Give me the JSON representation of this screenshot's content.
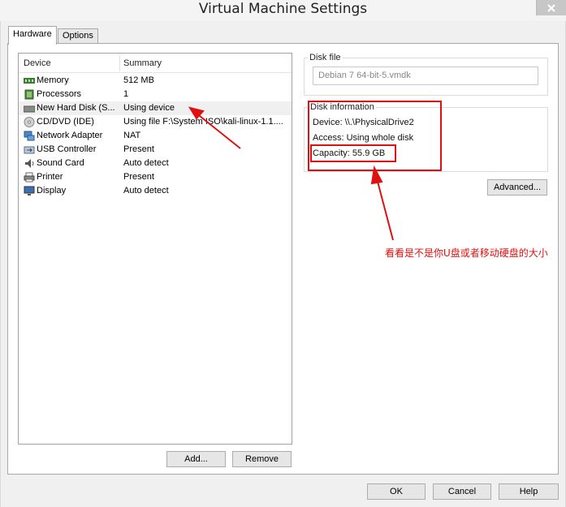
{
  "window": {
    "title": "Virtual Machine Settings"
  },
  "tabs": [
    {
      "label": "Hardware"
    },
    {
      "label": "Options"
    }
  ],
  "devices": {
    "header": {
      "device": "Device",
      "summary": "Summary"
    },
    "rows": [
      {
        "name": "Memory",
        "summary": "512 MB",
        "icon": "memory-icon"
      },
      {
        "name": "Processors",
        "summary": "1",
        "icon": "processor-icon"
      },
      {
        "name": "New Hard Disk (S...",
        "summary": "Using device",
        "icon": "hard-disk-icon"
      },
      {
        "name": "CD/DVD (IDE)",
        "summary": "Using file F:\\System ISO\\kali-linux-1.1....",
        "icon": "cd-dvd-icon"
      },
      {
        "name": "Network Adapter",
        "summary": "NAT",
        "icon": "network-adapter-icon"
      },
      {
        "name": "USB Controller",
        "summary": "Present",
        "icon": "usb-icon"
      },
      {
        "name": "Sound Card",
        "summary": "Auto detect",
        "icon": "sound-icon"
      },
      {
        "name": "Printer",
        "summary": "Present",
        "icon": "printer-icon"
      },
      {
        "name": "Display",
        "summary": "Auto detect",
        "icon": "display-icon"
      }
    ],
    "add_label": "Add...",
    "remove_label": "Remove"
  },
  "disk_file": {
    "label": "Disk file",
    "value": "Debian 7 64-bit-5.vmdk"
  },
  "disk_info": {
    "label": "Disk information",
    "device": "Device:  \\\\.\\PhysicalDrive2",
    "access": "Access:  Using whole disk",
    "capacity": "Capacity:  55.9 GB"
  },
  "advanced_label": "Advanced...",
  "annotation": {
    "text": "看看是不是你U盘或者移动硬盘的大小",
    "color": "#e01010"
  },
  "footer": {
    "ok": "OK",
    "cancel": "Cancel",
    "help": "Help"
  }
}
